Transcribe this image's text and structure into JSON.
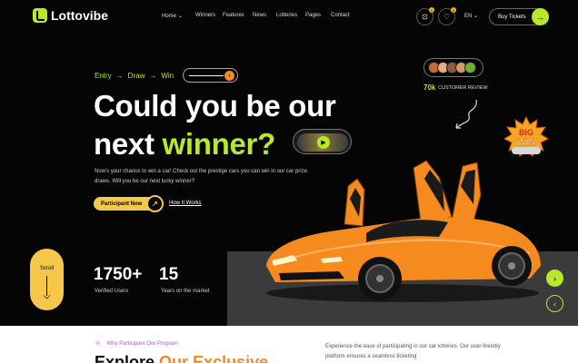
{
  "header": {
    "logo_text": "Lottovibe",
    "nav": [
      {
        "label": "Home",
        "has_dropdown": true
      },
      {
        "label": "Winners",
        "has_dropdown": false
      },
      {
        "label": "Features",
        "has_dropdown": false
      },
      {
        "label": "News",
        "has_dropdown": false
      },
      {
        "label": "Lotteries",
        "has_dropdown": false
      },
      {
        "label": "Pages",
        "has_dropdown": false
      },
      {
        "label": "Contact",
        "has_dropdown": false
      }
    ],
    "cart_badge": "0",
    "wishlist_badge": "0",
    "language": "EN",
    "buy_label": "Buy Tickets"
  },
  "hero": {
    "steps": [
      "Entry",
      "Draw",
      "Win"
    ],
    "headline_line1": "Could you be our",
    "headline_line2_a": "next",
    "headline_line2_b": "winner?",
    "description": "Now's your chance to win a car! Check out the prestige cars you can win in our car prize draws. Will you be our next lucky winner?",
    "participate_label": "Participant Now",
    "how_label": "How It Works"
  },
  "reviews": {
    "count": "70k",
    "label": "CUSTOMER REVIEW"
  },
  "badge": {
    "top": "BIG",
    "bottom": "WIN"
  },
  "stats": [
    {
      "value": "1750+",
      "label": "Verified Users"
    },
    {
      "value": "15",
      "label": "Years on the market"
    }
  ],
  "scroll_label": "Scroll",
  "section": {
    "eyebrow": "Why Participant Our Program",
    "title_a": "Explore",
    "title_b": "Our Exclusive",
    "description": "Experience the ease of participating in our car lotteries. Our user-friendly platform ensures a seamless ticketing"
  },
  "colors": {
    "accent_green": "#b9e82a",
    "accent_yellow": "#f5c84c",
    "car_orange": "#f58a1f",
    "background": "#050505"
  }
}
